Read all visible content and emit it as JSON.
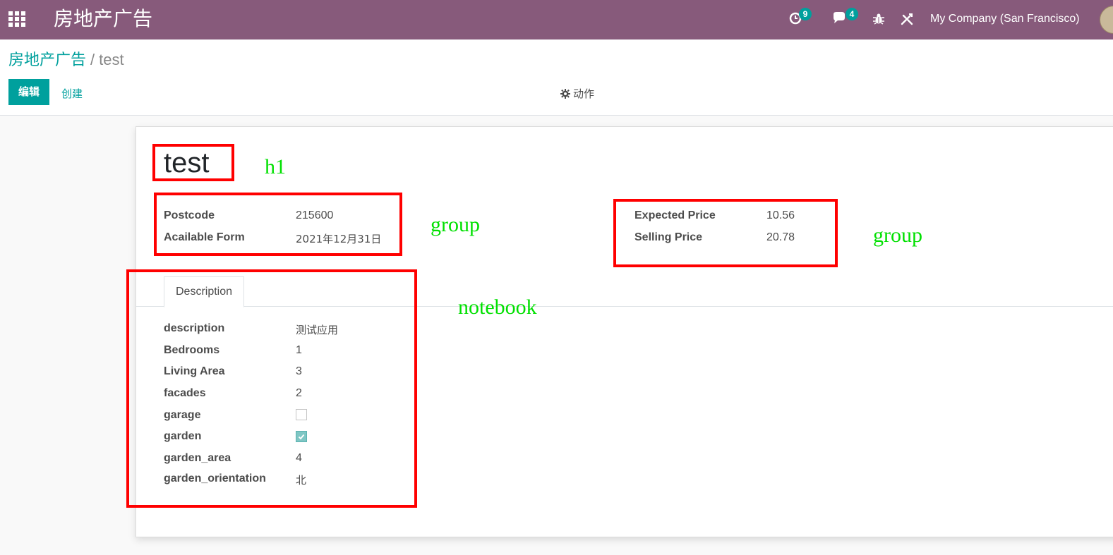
{
  "navbar": {
    "app_title": "房地产广告",
    "activity_count": "9",
    "message_count": "4",
    "company": "My Company (San Francisco)"
  },
  "breadcrumb": {
    "parent": "房地产广告",
    "separator": "/",
    "current": "test"
  },
  "buttons": {
    "edit": "编辑",
    "create": "创建",
    "action": "动作"
  },
  "record": {
    "title": "test",
    "group1": [
      {
        "label": "Postcode",
        "value": "215600"
      },
      {
        "label": "Acailable Form",
        "value": "2021年12月31日"
      }
    ],
    "group2": [
      {
        "label": "Expected Price",
        "value": "10.56"
      },
      {
        "label": "Selling Price",
        "value": "20.78"
      }
    ]
  },
  "notebook": {
    "tab": "Description",
    "fields": [
      {
        "label": "description",
        "value": "测试应用"
      },
      {
        "label": "Bedrooms",
        "value": "1"
      },
      {
        "label": "Living Area",
        "value": "3"
      },
      {
        "label": "facades",
        "value": "2"
      },
      {
        "label": "garage",
        "checked": false
      },
      {
        "label": "garden",
        "checked": true
      },
      {
        "label": "garden_area",
        "value": "4"
      },
      {
        "label": "garden_orientation",
        "value": "北"
      }
    ]
  },
  "annotations": {
    "h1": "h1",
    "group_left": "group",
    "group_right": "group",
    "notebook": "notebook"
  },
  "colors": {
    "navbar": "#875a7b",
    "primary": "#00a09d",
    "annotation_box": "#ff0000",
    "annotation_text": "#00e000"
  }
}
